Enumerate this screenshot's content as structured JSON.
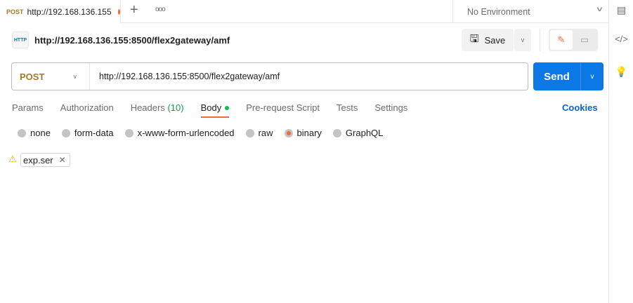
{
  "tab": {
    "method": "POST",
    "title": "http://192.168.136.155",
    "new_tab": "+",
    "more": "ooo"
  },
  "environment": {
    "selected": "No Environment"
  },
  "request": {
    "name": "http://192.168.136.155:8500/flex2gateway/amf",
    "icon_label": "HTTP",
    "method": "POST",
    "url": "http://192.168.136.155:8500/flex2gateway/amf"
  },
  "toolbar": {
    "save_label": "Save",
    "send_label": "Send"
  },
  "req_tabs": [
    {
      "label": "Params"
    },
    {
      "label": "Authorization"
    },
    {
      "label": "Headers",
      "count": "(10)"
    },
    {
      "label": "Body"
    },
    {
      "label": "Pre-request Script"
    },
    {
      "label": "Tests"
    },
    {
      "label": "Settings"
    }
  ],
  "cookies_label": "Cookies",
  "body_types": [
    "none",
    "form-data",
    "x-www-form-urlencoded",
    "raw",
    "binary",
    "GraphQL"
  ],
  "selected_body_type": "binary",
  "file": {
    "name": "exp.ser"
  },
  "colors": {
    "accent": "#f26b3a",
    "send": "#0c78e6",
    "link": "#0c63c9"
  }
}
